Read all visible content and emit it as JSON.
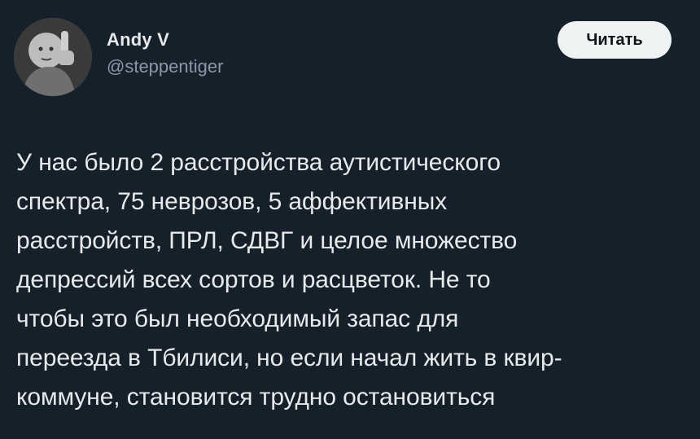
{
  "colors": {
    "background": "#15202b",
    "primary_text": "#e7e9ea",
    "secondary_text": "#8b98a5",
    "follow_button_bg": "#eff3f4",
    "follow_button_text": "#0f1419"
  },
  "author": {
    "display_name": "Andy V",
    "handle": "@steppentiger",
    "avatar_icon": "user-avatar"
  },
  "follow_button": {
    "label": "Читать"
  },
  "tweet": {
    "text": "У нас было 2 расстройства аутистического\nспектра, 75 неврозов, 5 аффективных\nрасстройств, ПРЛ, СДВГ и целое множество\nдепрессий всех сортов и расцветок. Не то\nчтобы это был необходимый запас для\nпереезда в Тбилиси, но если начал жить в квир-\nкоммуне, становится трудно остановиться"
  }
}
